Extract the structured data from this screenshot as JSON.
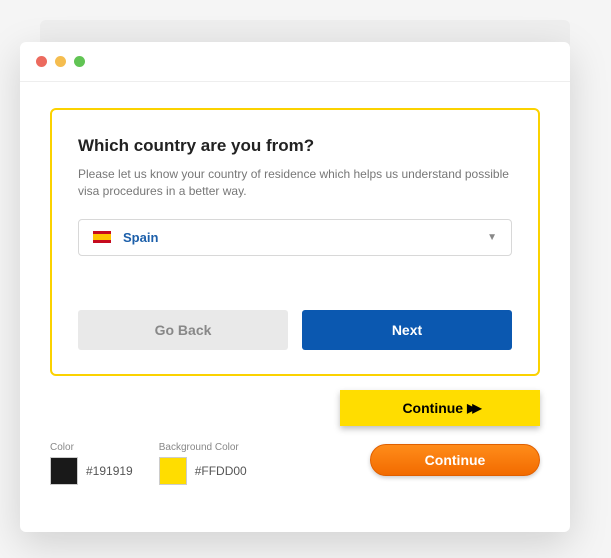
{
  "card": {
    "title": "Which country are you from?",
    "description": "Please let us know your country of residence which helps us understand possible visa procedures in a better way.",
    "country_select": {
      "selected": "Spain"
    },
    "go_back": "Go Back",
    "next": "Next"
  },
  "continue_buttons": {
    "yellow_label": "Continue",
    "orange_label": "Continue"
  },
  "colors": {
    "text": {
      "label": "Color",
      "hex": "#191919"
    },
    "bg": {
      "label": "Background Color",
      "hex": "#FFDD00"
    }
  }
}
